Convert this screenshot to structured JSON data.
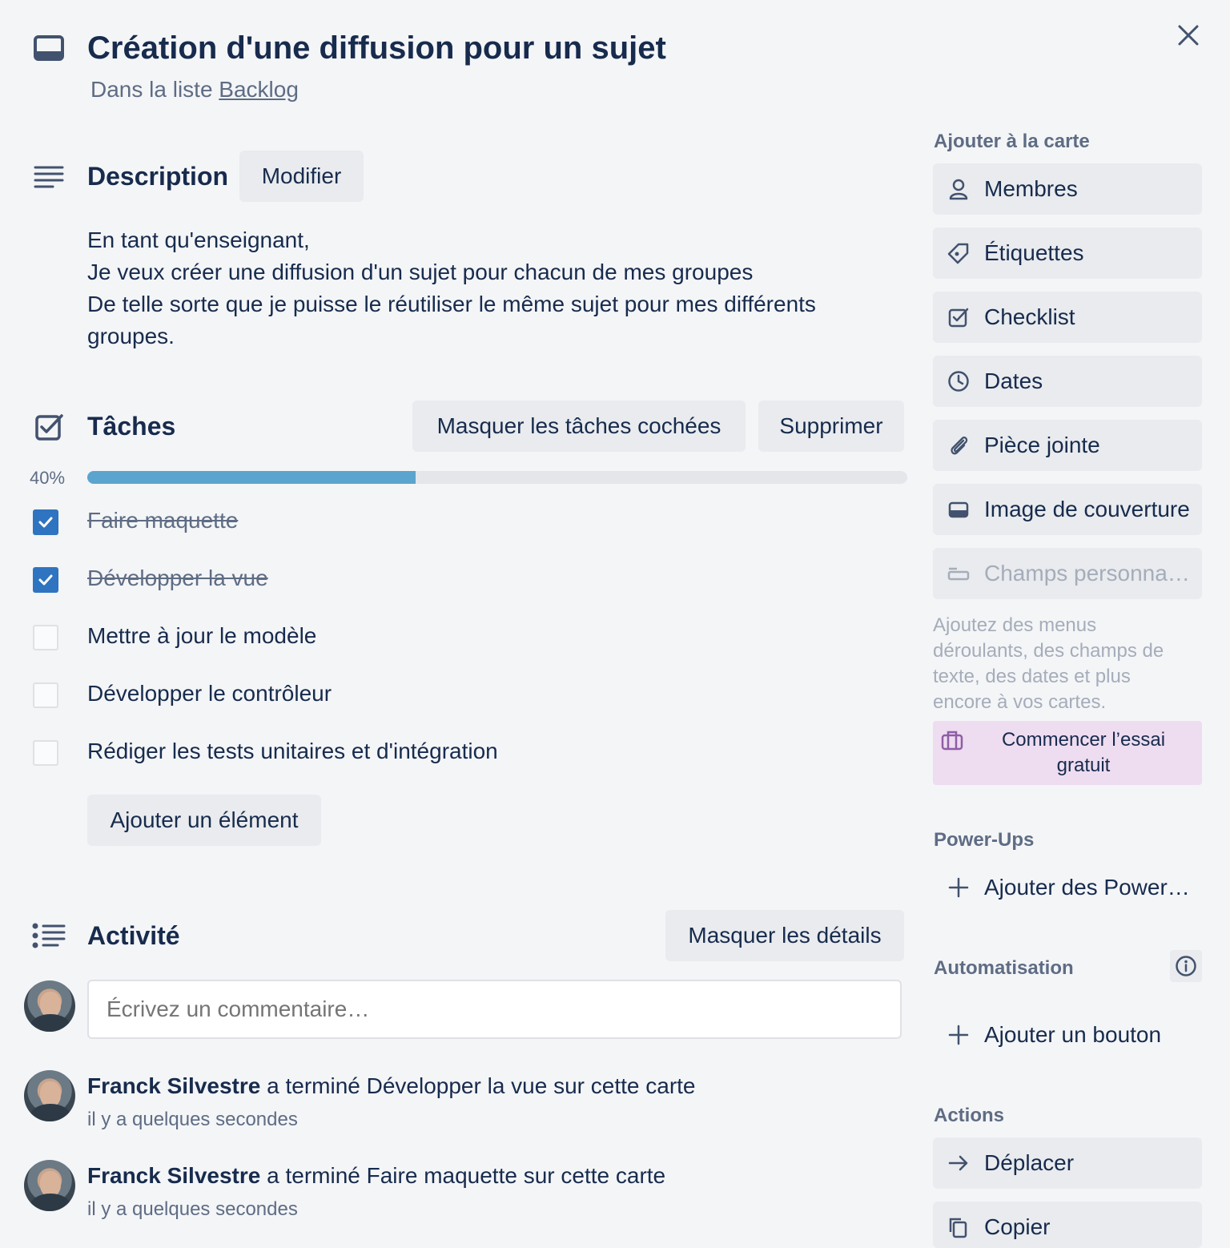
{
  "header": {
    "title": "Création d'une diffusion pour un sujet",
    "list_prefix": "Dans la liste",
    "list_name": "Backlog"
  },
  "description": {
    "title": "Description",
    "edit_label": "Modifier",
    "lines": [
      "En tant qu'enseignant,",
      "Je veux créer une diffusion d'un sujet pour chacun de mes groupes",
      "De telle sorte que je puisse le réutiliser le même sujet pour mes différents",
      "groupes."
    ]
  },
  "checklist": {
    "title": "Tâches",
    "hide_checked_label": "Masquer les tâches cochées",
    "delete_label": "Supprimer",
    "progress_text": "40%",
    "progress_fraction": 0.4,
    "items": [
      {
        "label": "Faire maquette",
        "checked": true
      },
      {
        "label": "Développer la vue",
        "checked": true
      },
      {
        "label": "Mettre à jour le modèle",
        "checked": false
      },
      {
        "label": "Développer le contrôleur",
        "checked": false
      },
      {
        "label": "Rédiger les tests unitaires et d'intégration",
        "checked": false
      }
    ],
    "add_item_label": "Ajouter un élément"
  },
  "activity": {
    "title": "Activité",
    "hide_details_label": "Masquer les détails",
    "comment_placeholder": "Écrivez un commentaire…",
    "entries": [
      {
        "author": "Franck Silvestre",
        "text": "a terminé Développer la vue sur cette carte",
        "time": "il y a quelques secondes"
      },
      {
        "author": "Franck Silvestre",
        "text": "a terminé Faire maquette sur cette carte",
        "time": "il y a quelques secondes"
      }
    ]
  },
  "sidebar": {
    "add_heading": "Ajouter à la carte",
    "add_items": [
      {
        "label": "Membres",
        "icon": "person-icon"
      },
      {
        "label": "Étiquettes",
        "icon": "tag-icon"
      },
      {
        "label": "Checklist",
        "icon": "checkbox-icon"
      },
      {
        "label": "Dates",
        "icon": "clock-icon"
      },
      {
        "label": "Pièce jointe",
        "icon": "paperclip-icon"
      },
      {
        "label": "Image de couverture",
        "icon": "card-cover-icon"
      }
    ],
    "custom_fields_label": "Champs personnalisés",
    "custom_fields_help": [
      "Ajoutez des menus",
      "déroulants, des champs de",
      "texte, des dates et plus",
      "encore à vos cartes."
    ],
    "trial_line1": "Commencer l’essai",
    "trial_line2": "gratuit",
    "powerups_heading": "Power-Ups",
    "add_powerups_label": "Ajouter des Power-Ups",
    "automation_heading": "Automatisation",
    "add_button_label": "Ajouter un bouton",
    "actions_heading": "Actions",
    "move_label": "Déplacer",
    "copy_label": "Copier"
  },
  "colors": {
    "accent": "#2f74c0",
    "progress": "#5ba4cf",
    "trial_bg": "#eedcf0",
    "muted": "#5e6c84"
  }
}
